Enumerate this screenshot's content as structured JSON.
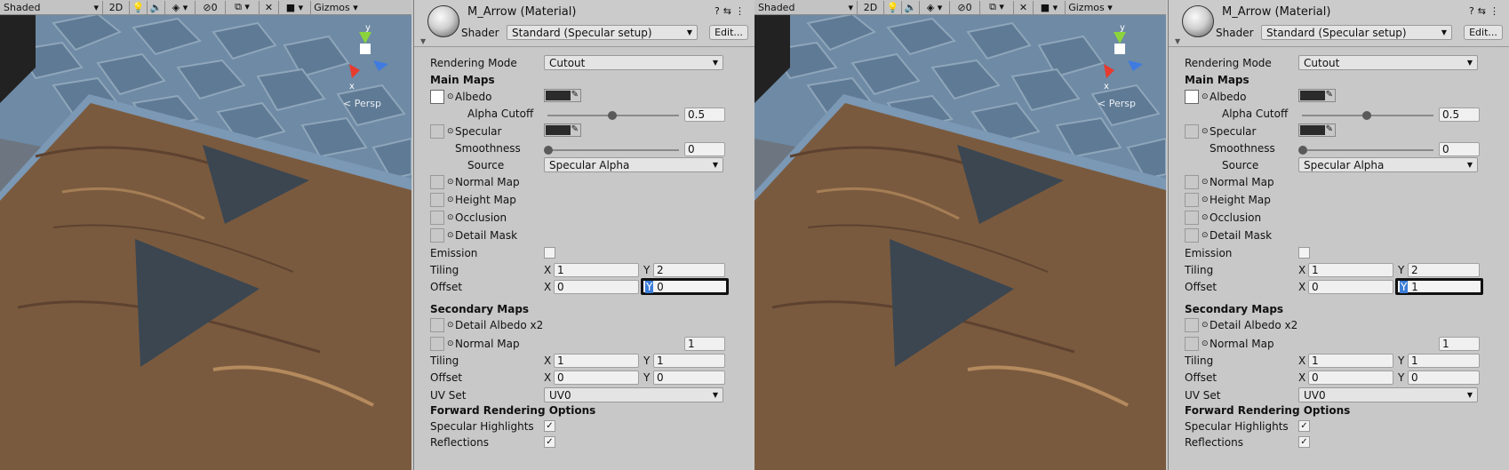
{
  "panels": [
    {
      "toolbar": {
        "shading": "Shaded",
        "mode_2d": "2D",
        "hidden_count": "0",
        "gizmos": "Gizmos"
      },
      "scene": {
        "persp_label": "< Persp",
        "axis_y": "y",
        "axis_x": "x"
      },
      "inspector": {
        "title": "M_Arrow (Material)",
        "shader_label": "Shader",
        "shader_value": "Standard (Specular setup)",
        "edit_label": "Edit...",
        "rendering_mode_label": "Rendering Mode",
        "rendering_mode_value": "Cutout",
        "main_maps": "Main Maps",
        "albedo": "Albedo",
        "alpha_cutoff_label": "Alpha Cutoff",
        "alpha_cutoff_value": "0.5",
        "specular": "Specular",
        "smoothness_label": "Smoothness",
        "smoothness_value": "0",
        "source_label": "Source",
        "source_value": "Specular Alpha",
        "normal_map": "Normal Map",
        "height_map": "Height Map",
        "occlusion": "Occlusion",
        "detail_mask": "Detail Mask",
        "emission": "Emission",
        "tiling_label": "Tiling",
        "tiling_x": "1",
        "tiling_y": "2",
        "offset_label": "Offset",
        "offset_x": "0",
        "offset_y": "0",
        "secondary_maps": "Secondary Maps",
        "detail_albedo": "Detail Albedo x2",
        "sec_normal_map": "Normal Map",
        "sec_normal_value": "1",
        "sec_tiling_x": "1",
        "sec_tiling_y": "1",
        "sec_offset_x": "0",
        "sec_offset_y": "0",
        "uv_set_label": "UV Set",
        "uv_set_value": "UV0",
        "forward_options": "Forward Rendering Options",
        "specular_highlights": "Specular Highlights",
        "reflections": "Reflections",
        "x_label": "X",
        "y_label": "Y"
      }
    },
    {
      "toolbar": {
        "shading": "Shaded",
        "mode_2d": "2D",
        "hidden_count": "0",
        "gizmos": "Gizmos"
      },
      "scene": {
        "persp_label": "< Persp",
        "axis_y": "y",
        "axis_x": "x"
      },
      "inspector": {
        "title": "M_Arrow (Material)",
        "shader_label": "Shader",
        "shader_value": "Standard (Specular setup)",
        "edit_label": "Edit...",
        "rendering_mode_label": "Rendering Mode",
        "rendering_mode_value": "Cutout",
        "main_maps": "Main Maps",
        "albedo": "Albedo",
        "alpha_cutoff_label": "Alpha Cutoff",
        "alpha_cutoff_value": "0.5",
        "specular": "Specular",
        "smoothness_label": "Smoothness",
        "smoothness_value": "0",
        "source_label": "Source",
        "source_value": "Specular Alpha",
        "normal_map": "Normal Map",
        "height_map": "Height Map",
        "occlusion": "Occlusion",
        "detail_mask": "Detail Mask",
        "emission": "Emission",
        "tiling_label": "Tiling",
        "tiling_x": "1",
        "tiling_y": "2",
        "offset_label": "Offset",
        "offset_x": "0",
        "offset_y": "1",
        "secondary_maps": "Secondary Maps",
        "detail_albedo": "Detail Albedo x2",
        "sec_normal_map": "Normal Map",
        "sec_normal_value": "1",
        "sec_tiling_x": "1",
        "sec_tiling_y": "1",
        "sec_offset_x": "0",
        "sec_offset_y": "0",
        "uv_set_label": "UV Set",
        "uv_set_value": "UV0",
        "forward_options": "Forward Rendering Options",
        "specular_highlights": "Specular Highlights",
        "reflections": "Reflections",
        "x_label": "X",
        "y_label": "Y"
      }
    }
  ],
  "colors": {
    "wood": "#7a5a3e",
    "tile": "#6f8ba6",
    "arrow": "#3b4651",
    "active_outline": "#111111",
    "highlight": "#3d7dd8"
  }
}
